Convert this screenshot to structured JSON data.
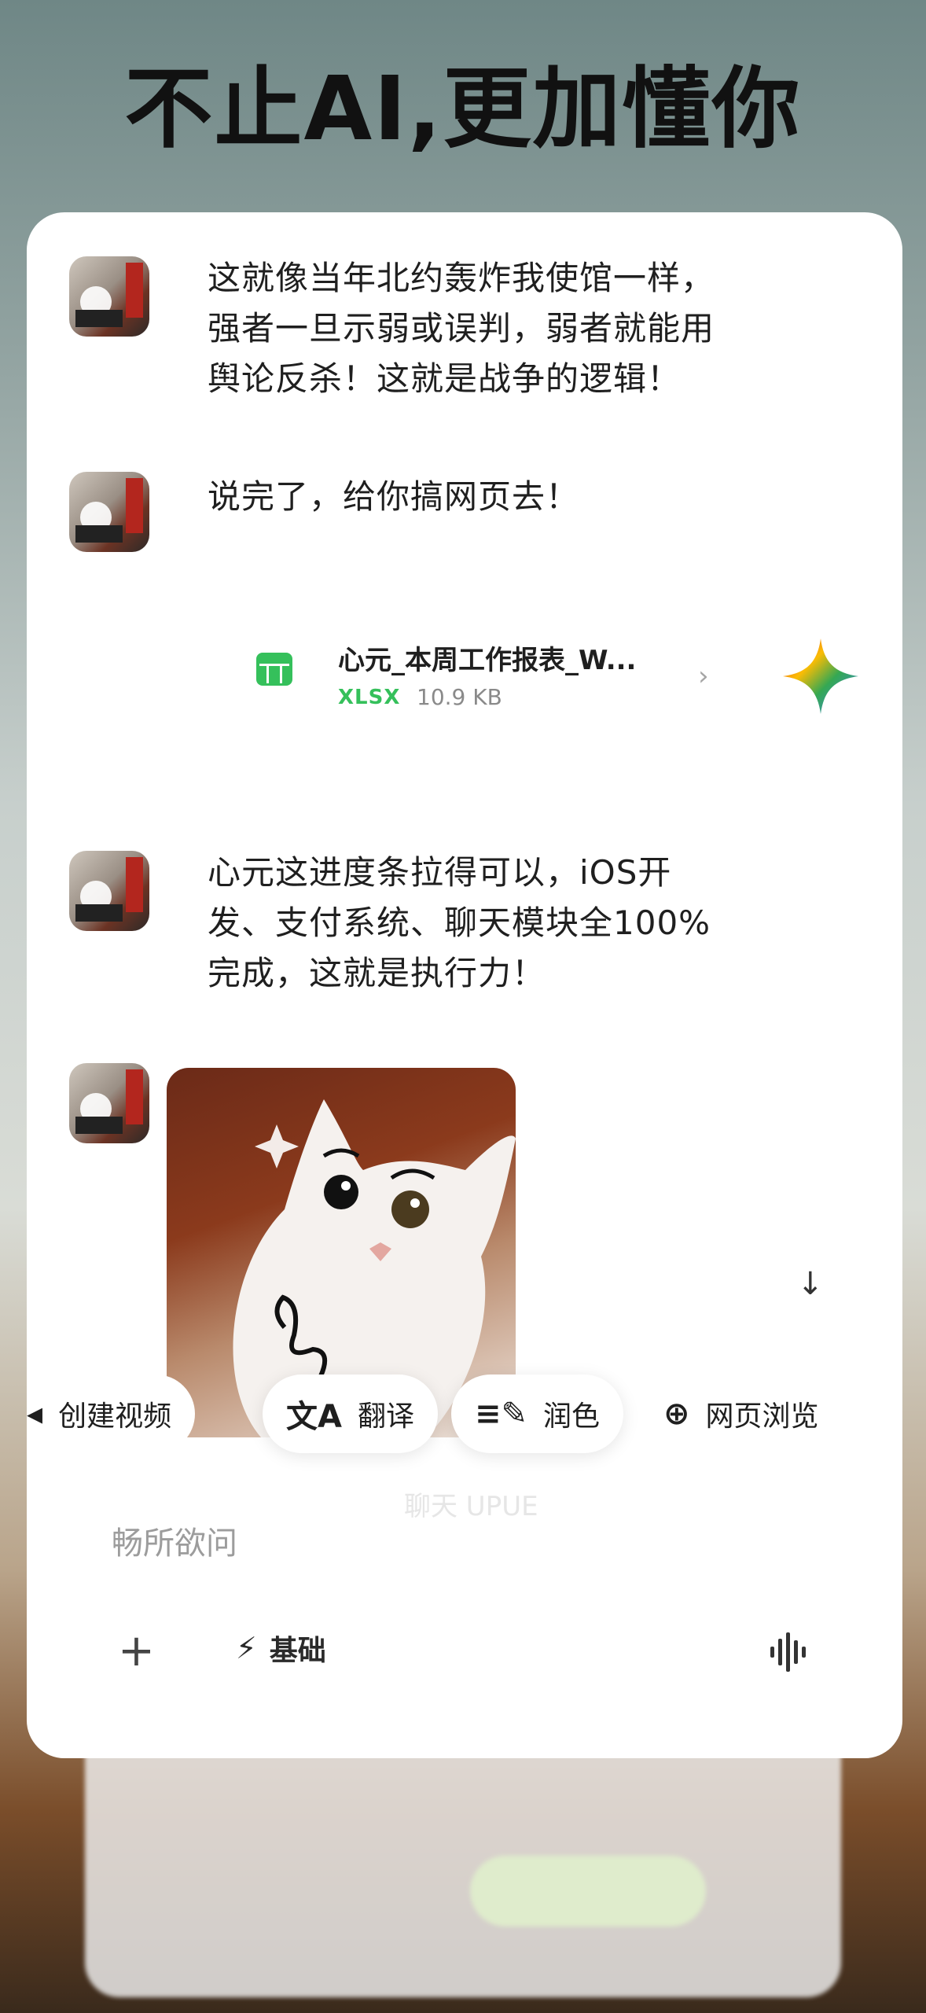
{
  "headline": "不止AI,更加懂你",
  "messages": [
    {
      "text_lines": [
        "这就像当年北约轰炸我使馆一样，",
        "强者一旦示弱或误判，弱者就能用",
        "舆论反杀！这就是战争的逻辑！"
      ]
    },
    {
      "text_lines": [
        "说完了，给你搞网页去！"
      ]
    },
    {
      "text_lines": [
        "心元这进度条拉得可以，iOS开",
        "发、支付系统、聊天模块全100%",
        "完成，这就是执行力！"
      ]
    }
  ],
  "file": {
    "name": "心元_本周工作报表_W...",
    "type": "XLSX",
    "size": "10.9 KB",
    "icon": "spreadsheet-icon",
    "accent": "#35c05b"
  },
  "chips": [
    {
      "label": "创建视频",
      "icon": "video-icon"
    },
    {
      "label": "翻译",
      "icon": "translate-icon"
    },
    {
      "label": "润色",
      "icon": "polish-icon"
    },
    {
      "label": "网页浏览",
      "icon": "globe-icon"
    }
  ],
  "ghost_label": "聊天 UPUE",
  "input": {
    "placeholder": "畅所欲问"
  },
  "bottom": {
    "mode_label": "基础"
  }
}
